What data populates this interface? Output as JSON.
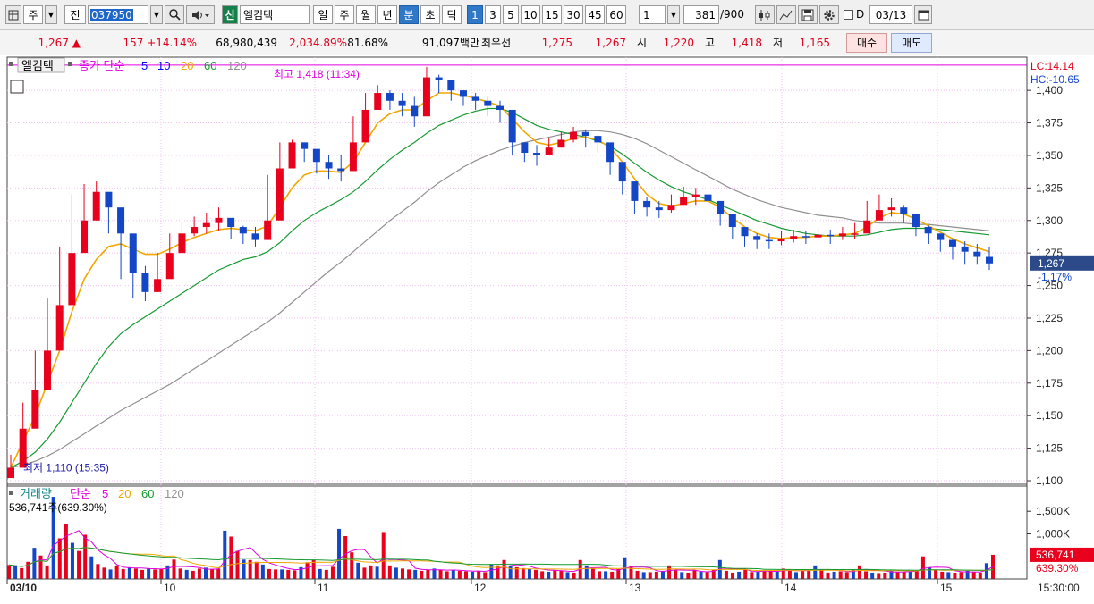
{
  "toolbar": {
    "market_label": "주",
    "prev_label": "전",
    "code_value": "037950",
    "credit_badge": "신",
    "stock_name": "엘컴텍",
    "period_day": "일",
    "period_week": "주",
    "period_month": "월",
    "period_year": "년",
    "period_min": "분",
    "period_sec": "초",
    "period_tick": "틱",
    "intervals": [
      "1",
      "3",
      "5",
      "10",
      "15",
      "30",
      "45",
      "60"
    ],
    "interval_select": "1",
    "count_value": "381",
    "count_total": "/900",
    "date_checkbox_label": "D",
    "date_value": "03/13",
    "icons": [
      "search-icon",
      "sound-icon",
      "candle-icon",
      "draw-icon",
      "save-icon",
      "gear-icon",
      "calendar-icon"
    ]
  },
  "info": {
    "price": "1,267 ▲",
    "change": "157 +14.14%",
    "volume": "68,980,439",
    "volume_ratio": "2,034.89%",
    "turnover": "81.68%",
    "amount": "91,097백만",
    "best_label": "최우선",
    "best_ask": "1,275",
    "best_bid": "1,267",
    "open_label": "시",
    "open": "1,220",
    "high_label": "고",
    "high": "1,418",
    "low_label": "저",
    "low": "1,165",
    "buy_label": "매수",
    "sell_label": "매도"
  },
  "chart_data": [
    {
      "type": "candlestick",
      "legend": {
        "name": "엘컴텍",
        "ma_label": "종가 단순",
        "ma_periods": [
          "5",
          "10",
          "20",
          "60",
          "120"
        ]
      },
      "colors": {
        "up": "#e8001c",
        "down": "#1446c8",
        "ma5": "#0000ff",
        "ma10": "#0000ff",
        "ma20": "#f0a800",
        "ma60": "#159a30",
        "ma120": "#909090",
        "high_line": "#e000e0",
        "low_line": "#1a1aa8",
        "grid": "#f3c0f3"
      },
      "x_labels": [
        "03/10",
        "10",
        "11",
        "12",
        "13",
        "14",
        "15"
      ],
      "time_label": "15:30:00",
      "y_ticks": [
        1400,
        1375,
        1350,
        1325,
        1300,
        1275,
        1250,
        1225,
        1200,
        1175,
        1150,
        1125,
        1100
      ],
      "y_range": [
        1100,
        1420
      ],
      "high_annotation": "최고 1,418 (11:34)",
      "low_annotation": "최저 1,110 (15:35)",
      "high_value": 1418,
      "low_value": 1110,
      "current_price": "1,267",
      "current_change": "-1.17%",
      "right_top_1": "LC:14.14",
      "right_top_2": "HC:-10.65",
      "close_series": [
        1110,
        1140,
        1170,
        1200,
        1235,
        1275,
        1300,
        1322,
        1310,
        1290,
        1260,
        1245,
        1255,
        1275,
        1290,
        1295,
        1298,
        1302,
        1295,
        1290,
        1285,
        1300,
        1340,
        1360,
        1355,
        1345,
        1340,
        1338,
        1360,
        1385,
        1398,
        1392,
        1388,
        1380,
        1410,
        1408,
        1400,
        1395,
        1392,
        1388,
        1385,
        1360,
        1352,
        1350,
        1356,
        1362,
        1368,
        1365,
        1360,
        1345,
        1330,
        1315,
        1310,
        1308,
        1312,
        1318,
        1320,
        1315,
        1305,
        1295,
        1288,
        1285,
        1284,
        1286,
        1288,
        1287,
        1289,
        1288,
        1290,
        1290,
        1300,
        1308,
        1310,
        1305,
        1295,
        1290,
        1285,
        1280,
        1276,
        1272,
        1267
      ],
      "high_series": [
        1120,
        1160,
        1200,
        1240,
        1280,
        1320,
        1328,
        1330,
        1318,
        1300,
        1275,
        1265,
        1275,
        1290,
        1300,
        1303,
        1306,
        1310,
        1300,
        1296,
        1295,
        1335,
        1360,
        1362,
        1360,
        1352,
        1350,
        1350,
        1380,
        1398,
        1404,
        1400,
        1398,
        1395,
        1418,
        1412,
        1407,
        1400,
        1398,
        1395,
        1392,
        1370,
        1360,
        1358,
        1363,
        1368,
        1372,
        1370,
        1366,
        1355,
        1340,
        1325,
        1318,
        1315,
        1320,
        1326,
        1325,
        1320,
        1312,
        1300,
        1294,
        1290,
        1290,
        1292,
        1293,
        1292,
        1294,
        1293,
        1295,
        1298,
        1315,
        1320,
        1317,
        1312,
        1302,
        1296,
        1290,
        1286,
        1284,
        1282,
        1280
      ],
      "low_series": [
        1105,
        1130,
        1160,
        1190,
        1220,
        1265,
        1290,
        1300,
        1290,
        1255,
        1240,
        1238,
        1245,
        1265,
        1285,
        1288,
        1290,
        1292,
        1286,
        1282,
        1280,
        1290,
        1330,
        1350,
        1345,
        1336,
        1332,
        1330,
        1348,
        1375,
        1388,
        1385,
        1380,
        1372,
        1398,
        1398,
        1392,
        1388,
        1385,
        1380,
        1375,
        1350,
        1345,
        1342,
        1350,
        1356,
        1360,
        1356,
        1352,
        1335,
        1320,
        1305,
        1303,
        1302,
        1306,
        1312,
        1312,
        1306,
        1296,
        1286,
        1280,
        1278,
        1278,
        1281,
        1283,
        1282,
        1284,
        1282,
        1285,
        1286,
        1293,
        1303,
        1303,
        1298,
        1288,
        1282,
        1276,
        1270,
        1266,
        1266,
        1262
      ],
      "ma20_series": [
        1110,
        1130,
        1150,
        1175,
        1200,
        1230,
        1255,
        1270,
        1280,
        1282,
        1278,
        1274,
        1274,
        1278,
        1283,
        1287,
        1290,
        1293,
        1294,
        1293,
        1292,
        1296,
        1310,
        1325,
        1335,
        1338,
        1338,
        1337,
        1345,
        1360,
        1375,
        1382,
        1385,
        1385,
        1392,
        1398,
        1398,
        1396,
        1394,
        1391,
        1388,
        1378,
        1368,
        1360,
        1358,
        1360,
        1363,
        1364,
        1362,
        1356,
        1345,
        1332,
        1320,
        1313,
        1311,
        1313,
        1315,
        1315,
        1310,
        1302,
        1295,
        1290,
        1287,
        1286,
        1287,
        1287,
        1288,
        1288,
        1289,
        1290,
        1295,
        1302,
        1306,
        1305,
        1301,
        1296,
        1291,
        1286,
        1282,
        1279,
        1276
      ],
      "ma60_series": [
        1110,
        1115,
        1122,
        1132,
        1145,
        1160,
        1175,
        1190,
        1203,
        1213,
        1220,
        1226,
        1232,
        1238,
        1244,
        1250,
        1256,
        1262,
        1266,
        1270,
        1272,
        1276,
        1283,
        1292,
        1300,
        1306,
        1311,
        1316,
        1322,
        1330,
        1339,
        1347,
        1354,
        1360,
        1367,
        1373,
        1377,
        1381,
        1384,
        1386,
        1386,
        1383,
        1378,
        1373,
        1370,
        1368,
        1366,
        1364,
        1361,
        1357,
        1351,
        1344,
        1337,
        1331,
        1326,
        1322,
        1319,
        1316,
        1312,
        1308,
        1304,
        1300,
        1297,
        1294,
        1292,
        1290,
        1289,
        1288,
        1288,
        1288,
        1289,
        1291,
        1293,
        1294,
        1294,
        1294,
        1293,
        1292,
        1291,
        1290,
        1289
      ],
      "ma120_series": [
        1110,
        1112,
        1115,
        1119,
        1124,
        1130,
        1136,
        1142,
        1148,
        1154,
        1159,
        1164,
        1169,
        1174,
        1180,
        1186,
        1192,
        1198,
        1204,
        1210,
        1216,
        1222,
        1229,
        1237,
        1245,
        1253,
        1261,
        1268,
        1276,
        1284,
        1292,
        1300,
        1307,
        1314,
        1322,
        1329,
        1335,
        1341,
        1346,
        1350,
        1354,
        1357,
        1360,
        1362,
        1364,
        1366,
        1368,
        1369,
        1369,
        1368,
        1366,
        1363,
        1359,
        1354,
        1349,
        1344,
        1339,
        1334,
        1329,
        1324,
        1320,
        1316,
        1313,
        1310,
        1308,
        1306,
        1304,
        1303,
        1302,
        1300,
        1299,
        1298,
        1298,
        1298,
        1297,
        1297,
        1296,
        1295,
        1294,
        1293,
        1292
      ]
    },
    {
      "type": "bar",
      "legend": {
        "name": "거래량",
        "ma_label": "단순",
        "ma_periods": [
          "5",
          "20",
          "60",
          "120"
        ]
      },
      "current_text": "536,741주(639.30%)",
      "y_ticks": [
        "1,500K",
        "1,000K"
      ],
      "y_tick_values": [
        1500,
        1000
      ],
      "y_range": [
        0,
        1900
      ],
      "current_value": "536,741",
      "current_ratio": "639.30%",
      "volume_k": [
        310,
        280,
        240,
        380,
        690,
        520,
        300,
        1820,
        900,
        1220,
        800,
        620,
        980,
        500,
        330,
        250,
        210,
        300,
        220,
        260,
        230,
        200,
        240,
        210,
        220,
        300,
        430,
        230,
        200,
        180,
        230,
        250,
        220,
        230,
        1070,
        940,
        620,
        430,
        420,
        380,
        320,
        220,
        210,
        210,
        200,
        190,
        260,
        370,
        420,
        220,
        200,
        270,
        1110,
        950,
        590,
        360,
        250,
        300,
        270,
        1040,
        300,
        250,
        230,
        210,
        200,
        180,
        200,
        230,
        200,
        170,
        190,
        180,
        170,
        160,
        180,
        150,
        320,
        300,
        420,
        280,
        260,
        240,
        220,
        200,
        170,
        160,
        200,
        180,
        150,
        140,
        420,
        300,
        240,
        170,
        170,
        160,
        220,
        480,
        280,
        180,
        150,
        150,
        160,
        180,
        300,
        200,
        150,
        140,
        190,
        160,
        150,
        200,
        420,
        180,
        140,
        160,
        200,
        150,
        160,
        190,
        170,
        160,
        230,
        200,
        150,
        180,
        180,
        300,
        200,
        140,
        160,
        170,
        150,
        200,
        300,
        170,
        140,
        130,
        140,
        200,
        150,
        160,
        170,
        180,
        500,
        260,
        200,
        160,
        150,
        140,
        150,
        180,
        160,
        140,
        350,
        536
      ]
    }
  ]
}
